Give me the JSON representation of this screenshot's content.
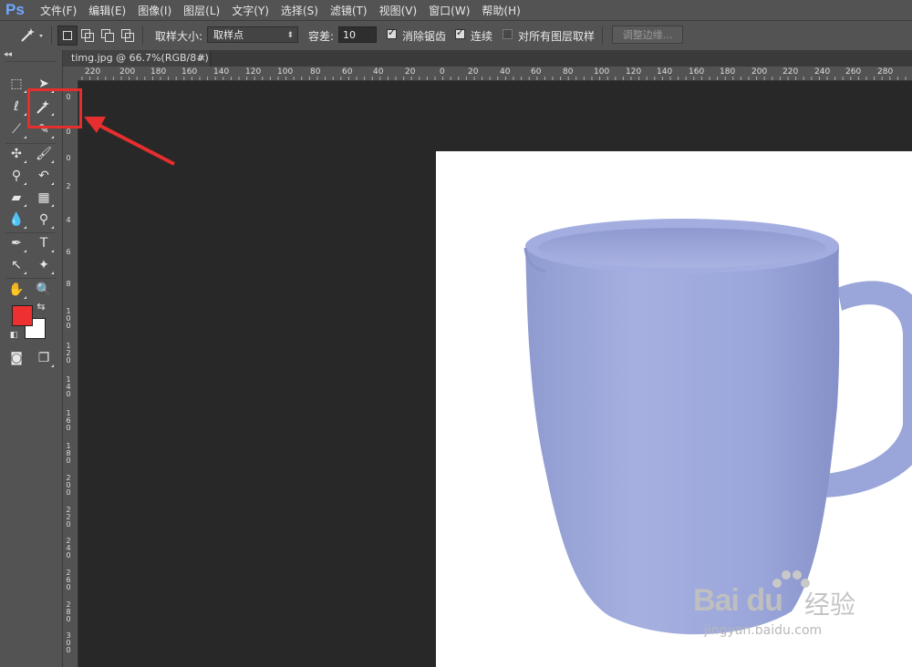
{
  "app": {
    "logo": "Ps"
  },
  "menu": [
    "文件(F)",
    "编辑(E)",
    "图像(I)",
    "图层(L)",
    "文字(Y)",
    "选择(S)",
    "滤镜(T)",
    "视图(V)",
    "窗口(W)",
    "帮助(H)"
  ],
  "options": {
    "sample_size_label": "取样大小:",
    "sample_size_value": "取样点",
    "tolerance_label": "容差:",
    "tolerance_value": "10",
    "antialias_label": "消除锯齿",
    "contiguous_label": "连续",
    "all_layers_label": "对所有图层取样",
    "refine_edge_label": "调整边缘..."
  },
  "document": {
    "tab_title": "timg.jpg @ 66.7%(RGB/8#)",
    "close": "×"
  },
  "ruler": {
    "h_labels": [
      "220",
      "200",
      "180",
      "160",
      "140",
      "120",
      "100",
      "80",
      "60",
      "40",
      "20",
      "0",
      "20",
      "40",
      "60",
      "80",
      "100",
      "120",
      "140",
      "160",
      "180",
      "200",
      "220",
      "240",
      "260",
      "280"
    ],
    "v_labels": [
      "0",
      "0",
      "0",
      "2",
      "4",
      "6",
      "8",
      "1 0 0",
      "1 2 0",
      "1 4 0",
      "1 6 0",
      "1 8 0",
      "2 0 0",
      "2 2 0",
      "2 4 0",
      "2 6 0",
      "2 8 0",
      "3 0 0"
    ]
  },
  "colors": {
    "foreground": "#ef3030",
    "background": "#ffffff",
    "highlight": "#e52e2e",
    "mug": "#9ea8d8"
  },
  "watermark": {
    "brand": "Bai du",
    "cn": "经验",
    "url": "jingyan.baidu.com"
  }
}
